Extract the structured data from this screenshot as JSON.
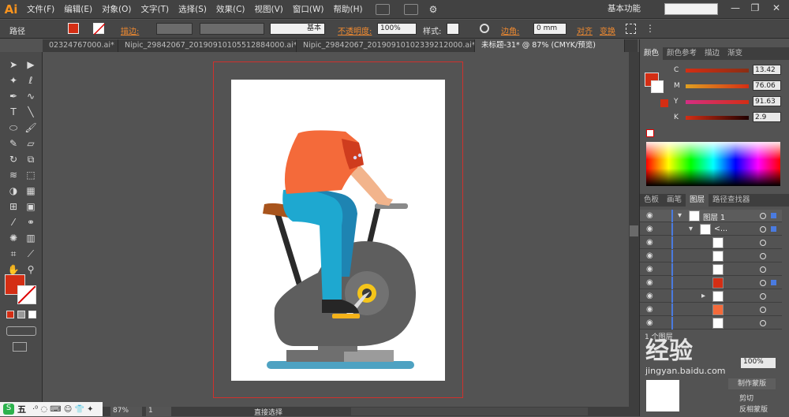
{
  "app": {
    "logo": "Ai"
  },
  "menu": [
    "文件(F)",
    "编辑(E)",
    "对象(O)",
    "文字(T)",
    "选择(S)",
    "效果(C)",
    "视图(V)",
    "窗口(W)",
    "帮助(H)"
  ],
  "workspace": "基本功能",
  "window_controls": [
    "—",
    "❐",
    "✕"
  ],
  "control": {
    "selection_type": "路径",
    "stroke_label": "描边:",
    "stroke_style": "基本",
    "opacity_label": "不透明度:",
    "opacity_value": "100%",
    "style_label": "样式:",
    "corner_label": "边角:",
    "corner_value": "0 mm",
    "align_label": "对齐",
    "transform_label": "变换",
    "fill_color": "#d42e14"
  },
  "tabs": [
    {
      "label": "02324767000.ai*",
      "active": false
    },
    {
      "label": "Nipic_29842067_20190910105512884000.ai*",
      "active": false
    },
    {
      "label": "Nipic_29842067_20190910102339212000.ai*",
      "active": false
    },
    {
      "label": "未标题-31* @ 87% (CMYK/预览)",
      "active": true
    }
  ],
  "color_panel": {
    "tabs": [
      "颜色",
      "颜色参考",
      "描边",
      "渐变"
    ],
    "channels": [
      {
        "name": "C",
        "value": "13.42",
        "level": 0.13
      },
      {
        "name": "M",
        "value": "76.06",
        "level": 0.76
      },
      {
        "name": "Y",
        "value": "91.63",
        "level": 0.92
      },
      {
        "name": "K",
        "value": "2.9",
        "level": 0.03
      }
    ]
  },
  "layers_panel": {
    "tabs": [
      "色板",
      "画笔",
      "图层",
      "路径查找器"
    ],
    "layer_name": "图层 1",
    "group_name": "<...",
    "count_label": "1 个图层"
  },
  "bottom": {
    "zoom": "87%",
    "page": "1",
    "status": "直接选择",
    "make_mask": "制作蒙版",
    "invert_mask": "反相蒙版",
    "clip": "剪切",
    "opacity_value": "100%"
  },
  "ime": {
    "label": "五"
  },
  "watermark": {
    "text": "经验",
    "sub": "jingyan.baidu.com"
  }
}
